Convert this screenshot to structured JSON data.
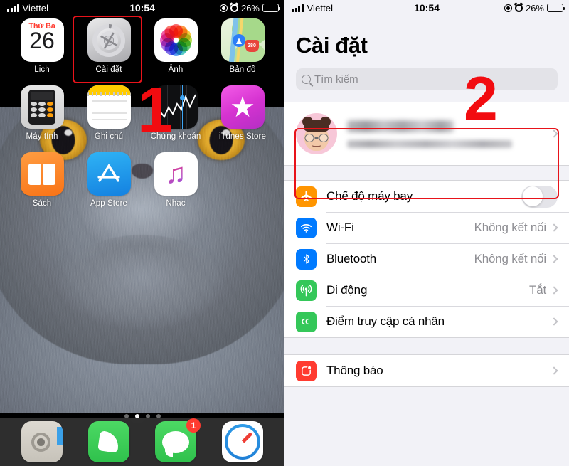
{
  "status_bar": {
    "carrier": "Viettel",
    "time": "10:54",
    "battery_percent": "26%",
    "icons": [
      "signal-bars-icon",
      "location-arrow-icon",
      "alarm-clock-icon",
      "battery-icon"
    ]
  },
  "home_screen": {
    "apps": [
      {
        "label": "Lịch",
        "icon": "calendar-icon",
        "calendar_dow": "Thứ Ba",
        "calendar_day": "26"
      },
      {
        "label": "Cài đặt",
        "icon": "settings-gear-icon"
      },
      {
        "label": "Ảnh",
        "icon": "photos-icon"
      },
      {
        "label": "Bản đồ",
        "icon": "maps-icon",
        "route_number": "280"
      },
      {
        "label": "Máy tính",
        "icon": "calculator-icon"
      },
      {
        "label": "Ghi chú",
        "icon": "notes-icon"
      },
      {
        "label": "Chứng khoán",
        "icon": "stocks-icon"
      },
      {
        "label": "iTunes Store",
        "icon": "itunes-store-icon"
      },
      {
        "label": "Sách",
        "icon": "books-icon"
      },
      {
        "label": "App Store",
        "icon": "app-store-icon"
      },
      {
        "label": "Nhạc",
        "icon": "music-icon"
      }
    ],
    "page_dots": {
      "count": 4,
      "active_index": 1
    },
    "dock": [
      {
        "name": "camera-app",
        "icon": "camera-icon",
        "badge": ""
      },
      {
        "name": "phone-app",
        "icon": "phone-handset-icon",
        "badge": ""
      },
      {
        "name": "messages-app",
        "icon": "messages-bubble-icon",
        "badge": "1"
      },
      {
        "name": "safari-app",
        "icon": "safari-compass-icon",
        "badge": ""
      }
    ]
  },
  "settings": {
    "title": "Cài đặt",
    "search_placeholder": "Tìm kiếm",
    "account": {
      "name": "",
      "subtitle": "",
      "avatar": "memoji-avatar",
      "redacted": true
    },
    "rows": [
      {
        "label": "Chế độ máy bay",
        "value": "",
        "control": "toggle",
        "toggle_on": false,
        "icon": "airplane-icon",
        "icon_color": "#ff9500"
      },
      {
        "label": "Wi-Fi",
        "value": "Không kết nối",
        "control": "chevron",
        "icon": "wifi-icon",
        "icon_color": "#007aff"
      },
      {
        "label": "Bluetooth",
        "value": "Không kết nối",
        "control": "chevron",
        "icon": "bluetooth-icon",
        "icon_color": "#007aff"
      },
      {
        "label": "Di động",
        "value": "Tắt",
        "control": "chevron",
        "icon": "cellular-antenna-icon",
        "icon_color": "#34c759"
      },
      {
        "label": "Điểm truy cập cá nhân",
        "value": "",
        "control": "chevron",
        "icon": "personal-hotspot-icon",
        "icon_color": "#34c759"
      }
    ],
    "rows_group2": [
      {
        "label": "Thông báo",
        "value": "",
        "control": "chevron",
        "icon": "notifications-icon",
        "icon_color": "#ff3b30"
      }
    ]
  },
  "annotations": {
    "step1": "1",
    "step2": "2",
    "accent_color": "#e8131a"
  }
}
